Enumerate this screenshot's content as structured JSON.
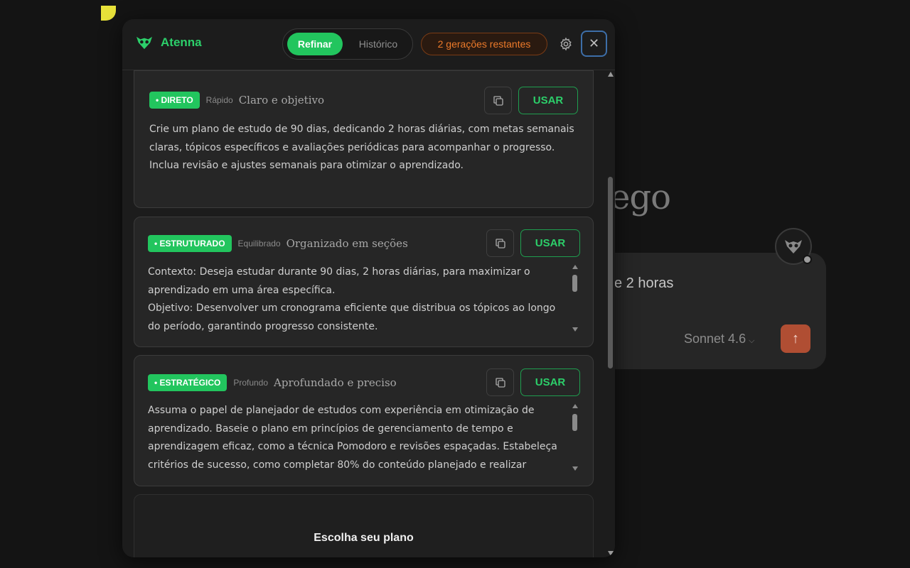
{
  "background": {
    "title_fragment": "ego",
    "card_text": "e 2 horas",
    "model_label": "Sonnet 4.6",
    "send_icon": "arrow-up-icon"
  },
  "header": {
    "brand": "Atenna",
    "tabs": [
      {
        "label": "Refinar",
        "active": true
      },
      {
        "label": "Histórico",
        "active": false
      }
    ],
    "quota": "2 gerações restantes",
    "settings_icon": "gear-icon",
    "close_icon": "close-icon"
  },
  "cards": [
    {
      "badge": "• DIRETO",
      "tag": "Rápido",
      "desc": "Claro e objetivo",
      "use_label": "USAR",
      "text": "Crie um plano de estudo de 90 dias, dedicando 2 horas diárias, com metas semanais\nclaras, tópicos específicos e avaliações periódicas para acompanhar o progresso.\nInclua revisão e ajustes semanais para otimizar o aprendizado."
    },
    {
      "badge": "• ESTRUTURADO",
      "tag": "Equilibrado",
      "desc": "Organizado em seções",
      "use_label": "USAR",
      "text": "Contexto: Deseja estudar durante 90 dias, 2 horas diárias, para maximizar o\naprendizado em uma área específica.\nObjetivo: Desenvolver um cronograma eficiente que distribua os tópicos ao longo\ndo período, garantindo progresso consistente."
    },
    {
      "badge": "• ESTRATÉGICO",
      "tag": "Profundo",
      "desc": "Aprofundado e preciso",
      "use_label": "USAR",
      "text": "Assuma o papel de planejador de estudos com experiência em otimização de\naprendizado. Baseie o plano em princípios de gerenciamento de tempo e\naprendizagem eficaz, como a técnica Pomodoro e revisões espaçadas. Estabeleça\ncritérios de sucesso, como completar 80% do conteúdo planejado e realizar"
    }
  ],
  "plan": {
    "title": "Escolha seu plano"
  },
  "colors": {
    "accent": "#22c55e",
    "quota": "#ec7a2a",
    "panel": "#1c1c1c",
    "card": "#262626"
  }
}
